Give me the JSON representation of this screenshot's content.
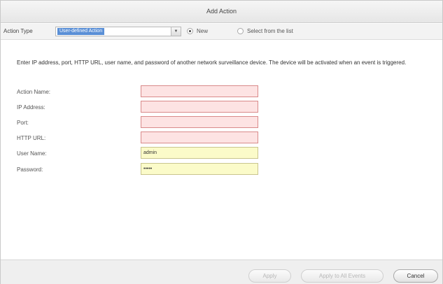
{
  "dialog": {
    "title": "Add Action"
  },
  "toolbar": {
    "action_type_label": "Action Type",
    "action_type_value": "User-defined Action",
    "radio_new_label": "New",
    "radio_new_checked": true,
    "radio_select_label": "Select from the list",
    "radio_select_checked": false
  },
  "form": {
    "description": "Enter IP address, port, HTTP URL, user name, and password of another network surveillance device. The device will be activated when an event is triggered.",
    "fields": [
      {
        "label": "Action Name:",
        "value": "",
        "state": "invalid"
      },
      {
        "label": "IP Address:",
        "value": "",
        "state": "invalid"
      },
      {
        "label": "Port:",
        "value": "",
        "state": "invalid"
      },
      {
        "label": "HTTP URL:",
        "value": "",
        "state": "invalid"
      },
      {
        "label": "User Name:",
        "value": "admin",
        "state": "valid"
      },
      {
        "label": "Password:",
        "value": "•••••",
        "state": "valid"
      }
    ]
  },
  "footer": {
    "apply_label": "Apply",
    "apply_all_label": "Apply to All Events",
    "cancel_label": "Cancel"
  },
  "colors": {
    "invalid_bg": "#fde3e3",
    "valid_bg": "#fbfbc9",
    "selection_blue": "#5a8fd6"
  }
}
